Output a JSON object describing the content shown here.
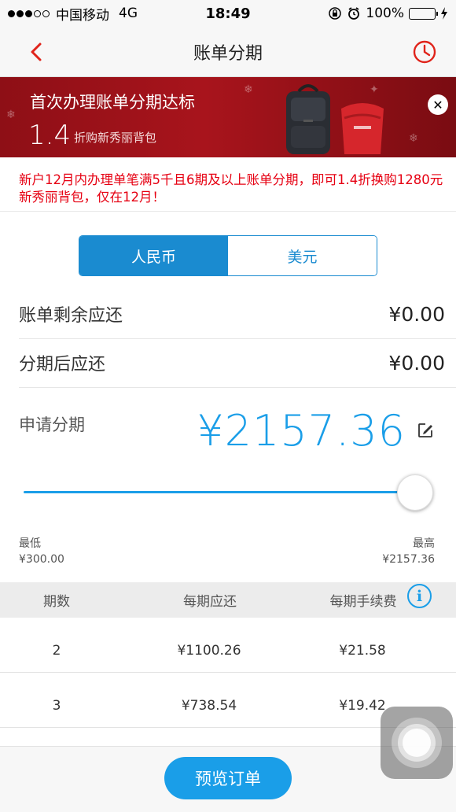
{
  "status_bar": {
    "carrier": "中国移动",
    "network": "4G",
    "time": "18:49",
    "battery": "100%",
    "signal_dots": 3,
    "battery_level": 1.0
  },
  "nav": {
    "title": "账单分期",
    "back_icon": "chevron-left-icon",
    "history_icon": "clock-icon"
  },
  "banner": {
    "title": "首次办理账单分期达标",
    "discount_number": "1.4",
    "discount_text": "折购新秀丽背包",
    "close_label": "✕"
  },
  "notice": {
    "text": "新户12月内办理单笔满5千且6期及以上账单分期，即可1.4折换购1280元新秀丽背包，仅在12月！"
  },
  "currency_tabs": {
    "rmb": "人民币",
    "usd": "美元",
    "selected": "rmb"
  },
  "summary": {
    "remaining_label": "账单剩余应还",
    "remaining_value": "¥0.00",
    "after_label": "分期后应还",
    "after_value": "¥0.00"
  },
  "apply": {
    "label": "申请分期",
    "amount": "¥2157.36"
  },
  "slider": {
    "min_label": "最低",
    "min_value": "¥300.00",
    "max_label": "最高",
    "max_value": "¥2157.36",
    "position": 1.0
  },
  "table": {
    "headers": [
      "期数",
      "每期应还",
      "每期手续费"
    ],
    "info_label": "i",
    "rows": [
      {
        "periods": "2",
        "per_period": "¥1100.26",
        "fee": "¥21.58"
      },
      {
        "periods": "3",
        "per_period": "¥738.54",
        "fee": "¥19.42"
      }
    ]
  },
  "bottom": {
    "preview_label": "预览订单"
  },
  "colors": {
    "accent": "#1a9ee8",
    "tab_blue": "#1a8bd0",
    "notice_red": "#e60012",
    "back_red": "#e0241b",
    "banner_red": "#a8141c"
  }
}
